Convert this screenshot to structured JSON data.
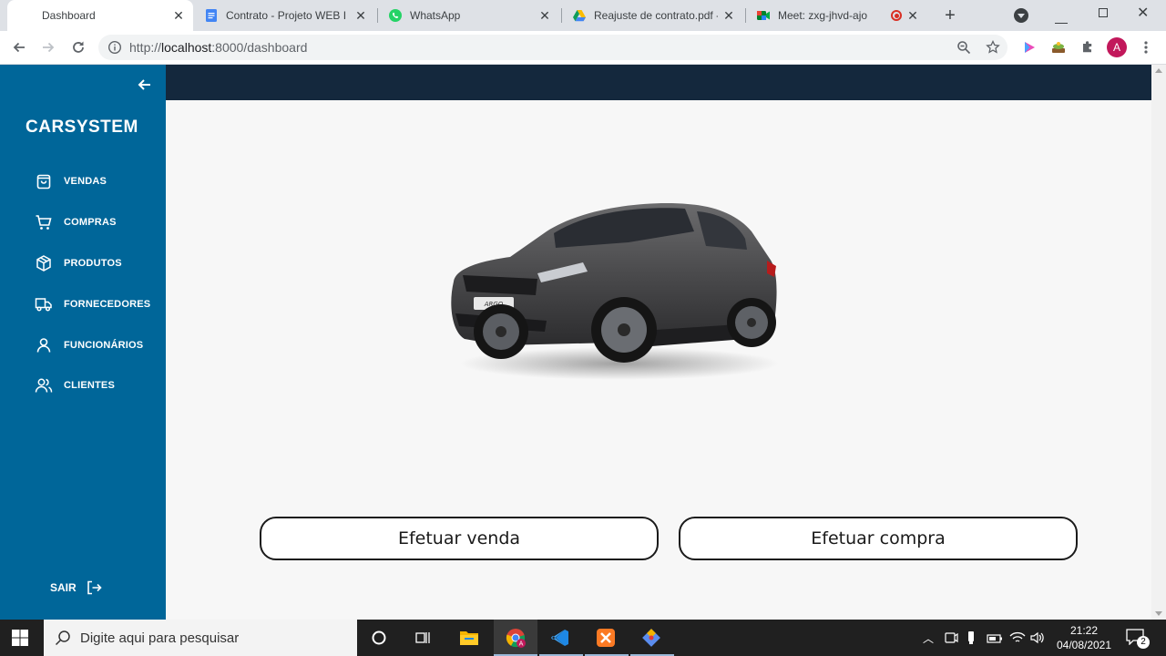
{
  "browser": {
    "tabs": [
      {
        "title": "Dashboard",
        "icon": "blank-page-icon",
        "active": true
      },
      {
        "title": "Contrato - Projeto WEB I -",
        "icon": "google-docs-icon"
      },
      {
        "title": "WhatsApp",
        "icon": "whatsapp-icon"
      },
      {
        "title": "Reajuste de contrato.pdf -",
        "icon": "google-drive-icon"
      },
      {
        "title": "Meet: zxg-jhvd-ajo",
        "icon": "google-meet-icon"
      }
    ],
    "url_prefix": "http://",
    "url_host": "localhost",
    "url_rest": ":8000/dashboard",
    "profile_initial": "A"
  },
  "app": {
    "brand": "CARSYSTEM",
    "nav": [
      {
        "label": "VENDAS",
        "icon": "shopping-bag-icon"
      },
      {
        "label": "COMPRAS",
        "icon": "shopping-cart-icon"
      },
      {
        "label": "PRODUTOS",
        "icon": "box-icon"
      },
      {
        "label": "FORNECEDORES",
        "icon": "truck-icon"
      },
      {
        "label": "FUNCIONÁRIOS",
        "icon": "user-icon"
      },
      {
        "label": "CLIENTES",
        "icon": "users-icon"
      }
    ],
    "logout_label": "SAIR",
    "car_badge": "ARGO",
    "actions": {
      "sell": "Efetuar venda",
      "buy": "Efetuar compra"
    },
    "colors": {
      "sidebar": "#006699",
      "topbar": "#14283d"
    }
  },
  "taskbar": {
    "search_placeholder": "Digite aqui para pesquisar",
    "time": "21:22",
    "date": "04/08/2021",
    "notifications": "2"
  }
}
